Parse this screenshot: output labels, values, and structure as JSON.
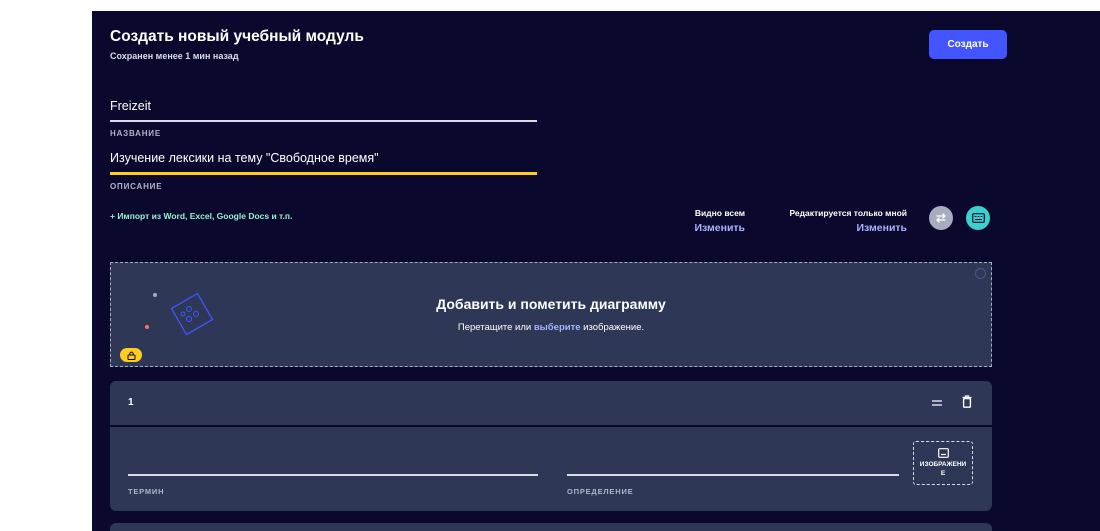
{
  "header": {
    "title": "Создать новый учебный модуль",
    "saved_status": "Сохранен менее 1 мин назад",
    "create_label": "Создать"
  },
  "form": {
    "title_value": "Freizeit",
    "title_label": "НАЗВАНИЕ",
    "description_value": "Изучение лексики на тему \"Свободное время\"",
    "description_label": "ОПИСАНИЕ"
  },
  "import_label": "+ Импорт из Word, Excel, Google Docs и т.п.",
  "visibility": {
    "visible_label": "Видно всем",
    "visible_change": "Изменить",
    "edit_label": "Редактируется только мной",
    "edit_change": "Изменить"
  },
  "icons": {
    "swap": "swap-icon",
    "keyboard": "keyboard-icon",
    "lock": "lock-icon",
    "drag": "drag-handle-icon",
    "trash": "trash-icon",
    "image": "image-icon"
  },
  "diagram": {
    "title": "Добавить и пометить диаграмму",
    "sub_before": "Перетащите или ",
    "sub_link": "выберите",
    "sub_after": " изображение."
  },
  "card": {
    "number": "1",
    "term_label": "ТЕРМИН",
    "definition_label": "ОПРЕДЕЛЕНИЕ",
    "image_label": "ИЗОБРАЖЕНИЕ"
  },
  "colors": {
    "background": "#0a092d",
    "surface": "#2e3856",
    "primary": "#4255ff",
    "accent_yellow": "#ffcd1f",
    "accent_mint": "#98f1d1",
    "link": "#a8b1ff",
    "keyboard_btn": "#3ccfcf",
    "swap_btn": "#a7acbf"
  }
}
